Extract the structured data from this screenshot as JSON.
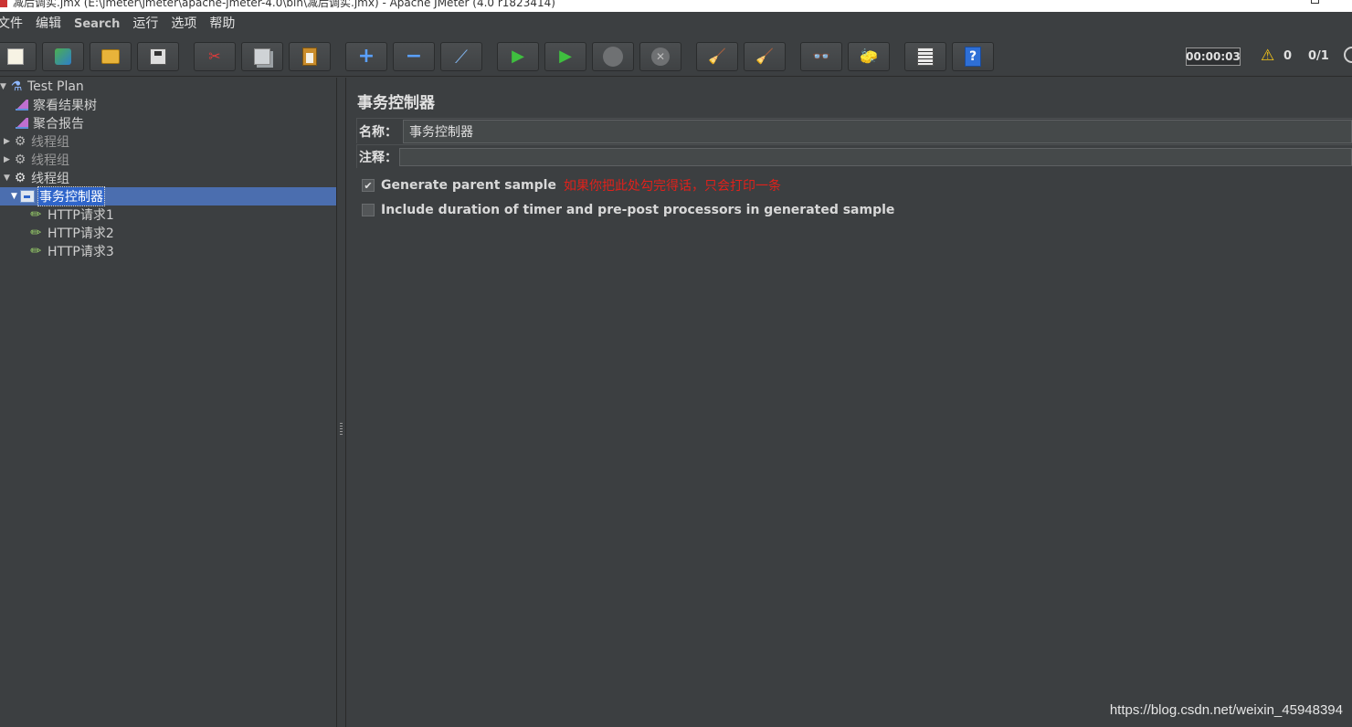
{
  "window": {
    "title": "减后调实.jmx (E:\\jmeter\\jmeter\\apache-jmeter-4.0\\bin\\减后调实.jmx) - Apache JMeter (4.0 r1823414)"
  },
  "menu": {
    "items": [
      "文件",
      "编辑",
      "Search",
      "运行",
      "选项",
      "帮助"
    ]
  },
  "toolbar": {
    "buttons": [
      {
        "icon": "new-icon"
      },
      {
        "icon": "templates-icon"
      },
      {
        "icon": "open-icon"
      },
      {
        "icon": "save-icon"
      },
      {
        "icon": "cut-icon",
        "glyph": "✂"
      },
      {
        "icon": "copy-icon"
      },
      {
        "icon": "paste-icon"
      },
      {
        "icon": "expand-icon",
        "glyph": "+"
      },
      {
        "icon": "collapse-icon",
        "glyph": "−"
      },
      {
        "icon": "toggle-icon",
        "glyph": "⟋"
      },
      {
        "icon": "start-icon",
        "glyph": "▶"
      },
      {
        "icon": "start-no-pause-icon",
        "glyph": "▶"
      },
      {
        "icon": "stop-icon"
      },
      {
        "icon": "shutdown-icon",
        "glyph": "✕"
      },
      {
        "icon": "clear-icon",
        "glyph": "🧹"
      },
      {
        "icon": "clear-all-icon",
        "glyph": "🧹"
      },
      {
        "icon": "search-binoculars-icon",
        "glyph": "👓"
      },
      {
        "icon": "reset-search-icon",
        "glyph": "🧽"
      },
      {
        "icon": "log-viewer-icon"
      },
      {
        "icon": "help-icon",
        "glyph": "?"
      }
    ],
    "timer": "00:00:03",
    "warning_count": "0",
    "threads": "0/1"
  },
  "tree": {
    "items": [
      {
        "label": "Test Plan",
        "icon": "test-plan-flask-icon",
        "expanded": true
      },
      {
        "label": "察看结果树",
        "icon": "listener-chart-icon"
      },
      {
        "label": "聚合报告",
        "icon": "listener-chart-icon"
      },
      {
        "label": "线程组",
        "icon": "thread-group-gear-icon",
        "expanded": false
      },
      {
        "label": "线程组",
        "icon": "thread-group-gear-icon",
        "expanded": false
      },
      {
        "label": "线程组",
        "icon": "thread-group-gear-icon",
        "expanded": true
      },
      {
        "label": "事务控制器",
        "icon": "transaction-controller-icon",
        "expanded": true,
        "selected": true
      },
      {
        "label": "HTTP请求1",
        "icon": "http-sampler-pipette-icon"
      },
      {
        "label": "HTTP请求2",
        "icon": "http-sampler-pipette-icon"
      },
      {
        "label": "HTTP请求3",
        "icon": "http-sampler-pipette-icon"
      }
    ]
  },
  "panel": {
    "title": "事务控制器",
    "name_label": "名称：",
    "name_value": "事务控制器",
    "comment_label": "注释：",
    "comment_value": "",
    "generate_parent_sample": {
      "label": "Generate parent sample",
      "checked": true,
      "annotation": "如果你把此处勾完得话，只会打印一条"
    },
    "include_duration": {
      "label": "Include duration of timer and pre-post processors in generated sample",
      "checked": false
    }
  },
  "watermark": "https://blog.csdn.net/weixin_45948394",
  "colors": {
    "background": "#3c3f41",
    "selection": "#4b6eaf",
    "annotation": "#e0211b",
    "start_green": "#3fbf3f"
  }
}
